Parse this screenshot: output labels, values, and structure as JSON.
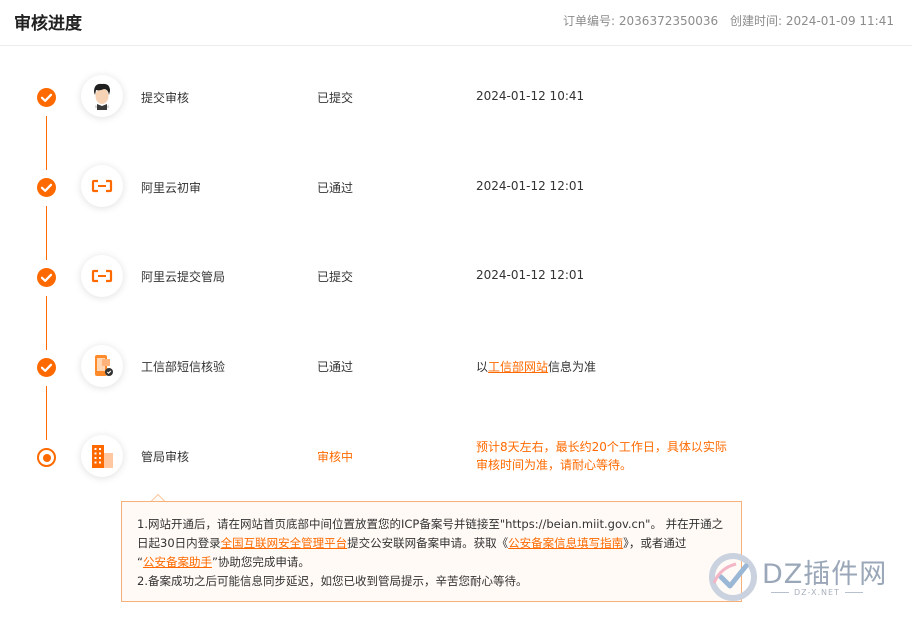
{
  "header": {
    "title": "审核进度",
    "order_label": "订单编号: 2036372350036",
    "created_label": "创建时间: 2024-01-09 11:41"
  },
  "steps": [
    {
      "name": "提交审核",
      "status": "已提交",
      "info": "2024-01-12 10:41",
      "icon": "user-avatar-icon",
      "state": "done"
    },
    {
      "name": "阿里云初审",
      "status": "已通过",
      "info": "2024-01-12 12:01",
      "icon": "aliyun-logo-icon",
      "state": "done"
    },
    {
      "name": "阿里云提交管局",
      "status": "已提交",
      "info": "2024-01-12 12:01",
      "icon": "aliyun-logo-icon",
      "state": "done"
    },
    {
      "name": "工信部短信核验",
      "status": "已通过",
      "info_prefix": "以",
      "info_link": "工信部网站",
      "info_suffix": "信息为准",
      "icon": "phone-verify-icon",
      "state": "done"
    },
    {
      "name": "管局审核",
      "status": "审核中",
      "info": "预计8天左右，最长约20个工作日，具体以实际审核时间为准，请耐心等待。",
      "icon": "building-icon",
      "state": "in-progress"
    }
  ],
  "notice": {
    "line1": "1.网站开通后，请在网站首页底部中间位置放置您的ICP备案号并链接至\"https://beian.miit.gov.cn\"。 并在开通之",
    "line2_a": "日起30日内登录",
    "line2_link1": "全国互联网安全管理平台",
    "line2_b": "提交公安联网备案申请。获取《",
    "line2_link2": "公安备案信息填写指南",
    "line2_c": "》，或者通过",
    "line3_a": "“",
    "line3_link": "公安备案助手",
    "line3_b": "”协助您完成申请。",
    "line4": "2.备案成功之后可能信息同步延迟，如您已收到管局提示，辛苦您耐心等待。"
  },
  "watermark": {
    "text": "DZ插件网",
    "sub": "DZ-X.NET"
  },
  "colors": {
    "accent": "#ff6a00",
    "notice_border": "#f7b07a",
    "notice_bg": "#fffaf6"
  }
}
